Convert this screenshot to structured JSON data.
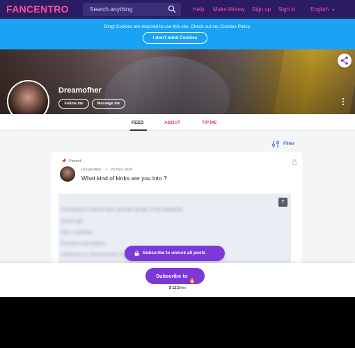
{
  "header": {
    "logo": "FANCENTRO",
    "search_placeholder": "Search anything",
    "links": {
      "help": "Help",
      "make_money": "Make Money",
      "sign_up": "Sign up",
      "sign_in": "Sign in"
    },
    "language": "English",
    "colors": {
      "nav_bg": "#2b1c63",
      "accent": "#ff4fa0"
    }
  },
  "cookie_banner": {
    "text": "Ding! Cookies are required to use this site. Check out our Cookies Policy.",
    "button": "I don't mind Cookies",
    "bg": "#1aa3f5"
  },
  "profile": {
    "name": "Dreamofher",
    "follow_button": "Follow me",
    "message_button": "Message me"
  },
  "tabs": [
    {
      "label": "FEED",
      "active": true
    },
    {
      "label": "ABOUT",
      "active": false
    },
    {
      "label": "TIP ME",
      "active": false
    }
  ],
  "filter_label": "Filter",
  "post": {
    "pinned_label": "Pinned",
    "author": "Dreamofher",
    "date": "26 Nov 2020",
    "meta_sep": "•",
    "title": "What kind of kinks are you into ?",
    "type_badge": "T",
    "unlock_button": "Subscribe to unlock all posts"
  },
  "footer": {
    "subscribe_button": "Subscribe to",
    "subscribe_emoji": "🔥",
    "price": "$ 12.5",
    "period": "/mo",
    "button_color": "#7d38d8"
  }
}
